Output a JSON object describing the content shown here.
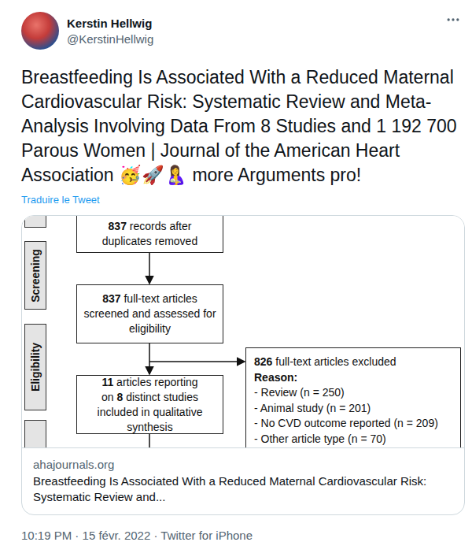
{
  "author": {
    "name": "Kerstin Hellwig",
    "handle": "@KerstinHellwig"
  },
  "tweet": {
    "text": "Breastfeeding Is Associated With a Reduced Maternal Cardiovascular Risk: Systematic Review and Meta-Analysis Involving Data From 8 Studies and 1 192 700 Parous Women | Journal of the American Heart Association 🥳🚀🤱 more Arguments pro!",
    "translate": "Traduire le Tweet"
  },
  "card": {
    "diagram": {
      "stages": [
        "Screening",
        "Eligibility"
      ],
      "boxes": [
        [
          {
            "text": "837",
            "bold": true
          },
          {
            "text": "records after duplicates removed",
            "bold": false
          }
        ],
        [
          {
            "text": "837",
            "bold": true
          },
          {
            "text": "full-text articles screened and assessed for eligibility",
            "bold": false
          }
        ],
        [
          {
            "text": "11",
            "bold": true
          },
          {
            "text": "articles reporting on",
            "bold": false
          },
          {
            "text": "8",
            "bold": true
          },
          {
            "text": "distinct studies included in qualitative synthesis",
            "bold": false
          }
        ]
      ],
      "excluded": {
        "heading": [
          {
            "text": "826",
            "bold": true
          },
          {
            "text": "full-text articles excluded",
            "bold": false
          }
        ],
        "reason": "Reason:",
        "items": [
          "- Review (n = 250)",
          "- Animal study (n = 201)",
          "- No CVD outcome reported (n = 209)",
          "- Other article type (n = 70)"
        ]
      }
    },
    "domain": "ahajournals.org",
    "title": "Breastfeeding Is Associated With a Reduced Maternal Cardiovascular Risk: Systematic Review and..."
  },
  "timestamp": "10:19 PM · 15 févr. 2022 · Twitter for iPhone"
}
